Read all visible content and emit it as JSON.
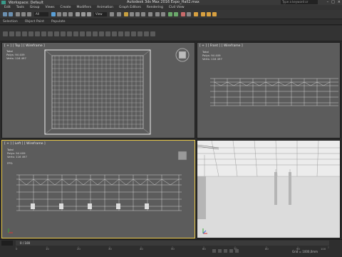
{
  "titlebar": {
    "workspace": "Workspace: Default",
    "app_title": "Autodesk 3ds Max 2016    Expo_Hall2.max",
    "search_placeholder": "Type a keyword or phrase"
  },
  "menubar": {
    "items": [
      "Edit",
      "Tools",
      "Group",
      "Views",
      "Create",
      "Modifiers",
      "Animation",
      "Graph Editors",
      "Rendering",
      "Civil View"
    ]
  },
  "toolbar": {
    "filter_value": "All",
    "view_value": "View"
  },
  "ribbon": {
    "items": [
      "Selection",
      "Object Paint",
      "Populate"
    ]
  },
  "viewports": {
    "top": {
      "label": "[ + ] [ Top ] [ Wireframe ]"
    },
    "front": {
      "label": "[ + ] [ Front ] [ Wireframe ]",
      "stats_total": "Total",
      "stats_polys": "Polys: 94 409",
      "stats_verts": "Verts: 116 497"
    },
    "left": {
      "label": "[ + ] [ Left ] [ Wireframe ]",
      "stats_total": "Total",
      "stats_polys": "Polys: 94 409",
      "stats_verts": "Verts: 116 497",
      "fps": "FPS:"
    },
    "top_stats": {
      "total": "Total",
      "polys": "Polys: 94 409",
      "verts": "Verts: 116 497"
    }
  },
  "timeline": {
    "frame": "0 / 100",
    "ticks": [
      "0",
      "10",
      "20",
      "30",
      "40",
      "50",
      "60",
      "70",
      "80",
      "90",
      "100"
    ]
  },
  "statusbar": {
    "grid": "Grid = 1000,0mm"
  }
}
